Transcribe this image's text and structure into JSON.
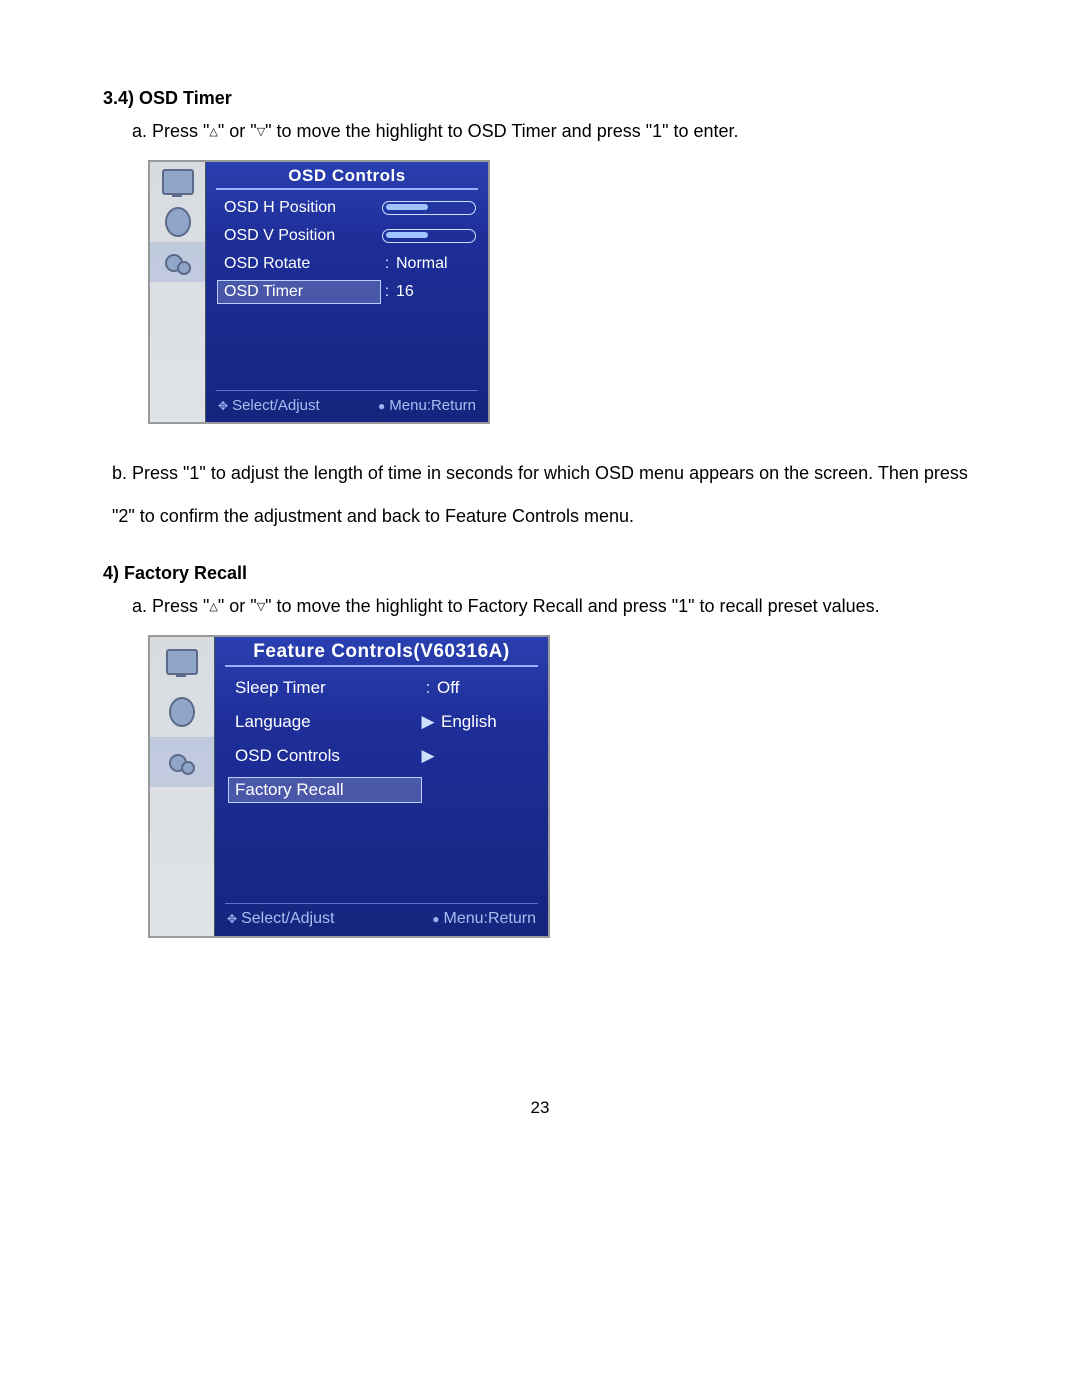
{
  "section34": {
    "heading": "3.4) OSD Timer",
    "step_a_pre": "a. Press \"",
    "step_a_mid1": "\" or \"",
    "step_a_mid2": "\" to move the highlight to OSD Timer and press \"1\" to enter.",
    "step_b": "b. Press \"1\" to adjust the length of time in seconds for which OSD menu appears on the screen. Then press \"2\" to confirm the adjustment and back to Feature Controls menu."
  },
  "section4": {
    "heading": "4) Factory Recall",
    "step_a_pre": "a. Press \"",
    "step_a_mid1": "\" or \"",
    "step_a_mid2": "\" to move the highlight to Factory Recall and press \"1\" to recall preset values."
  },
  "triangles": {
    "up": "△",
    "down": "▽"
  },
  "osd1": {
    "title": "OSD Controls",
    "rows": {
      "hpos": {
        "label": "OSD H Position",
        "value": ""
      },
      "vpos": {
        "label": "OSD V Position",
        "value": ""
      },
      "rotate": {
        "label": "OSD Rotate",
        "sep": ":",
        "value": "Normal"
      },
      "timer": {
        "label": "OSD Timer",
        "sep": ":",
        "value": "16"
      }
    },
    "footer_left": "Select/Adjust",
    "footer_right": "Menu:Return"
  },
  "osd2": {
    "title": "Feature Controls(V60316A)",
    "rows": {
      "sleep": {
        "label": "Sleep Timer",
        "sep": ":",
        "value": "Off"
      },
      "lang": {
        "label": "Language",
        "arrow": "▶",
        "value": "English"
      },
      "osdctl": {
        "label": "OSD Controls",
        "arrow": "▶",
        "value": ""
      },
      "recall": {
        "label": "Factory Recall"
      }
    },
    "footer_left": "Select/Adjust",
    "footer_right": "Menu:Return"
  },
  "page_number": "23"
}
